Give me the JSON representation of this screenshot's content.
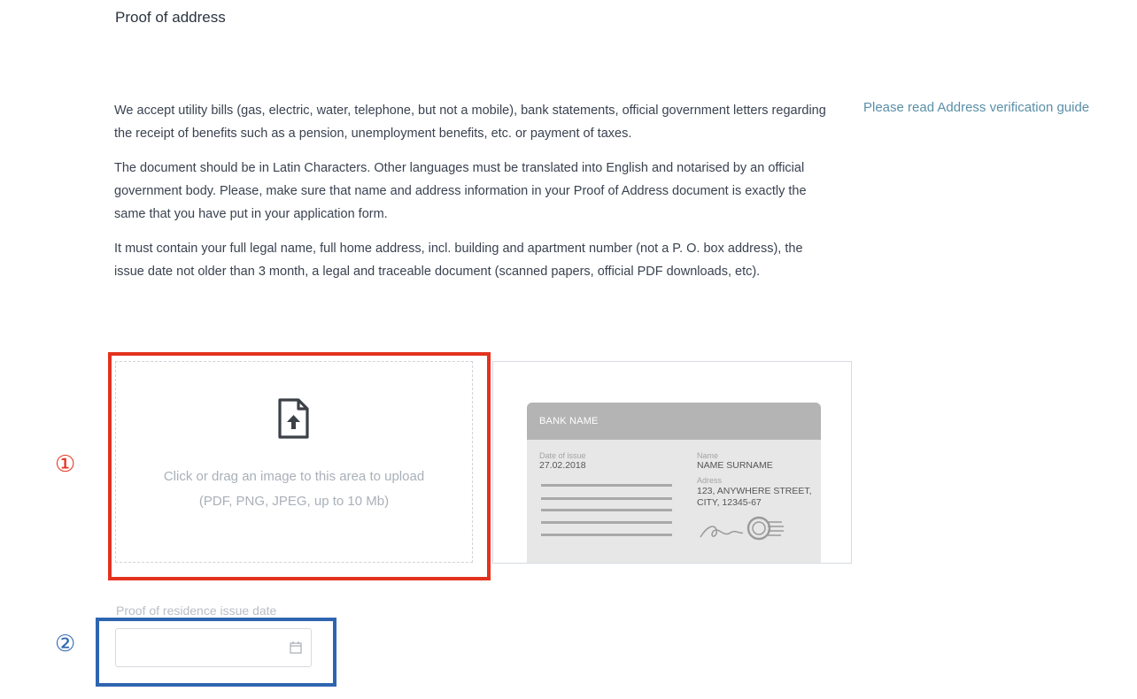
{
  "section": {
    "title": "Proof of address"
  },
  "description": {
    "paragraphs": [
      "We accept utility bills (gas, electric, water, telephone, but not a mobile), bank statements, official government letters regarding the receipt of benefits such as a pension, unemployment benefits, etc. or payment of taxes.",
      "The document should be in Latin Characters. Other languages must be translated into English and notarised by an official government body. Please, make sure that name and address information in your Proof of Address document is exactly the same that you have put in your application form.",
      "It must contain your full legal name, full home address, incl. building and apartment number (not a P. O. box address), the issue date not older than 3 month, a legal and traceable document (scanned papers, official PDF downloads, etc)."
    ]
  },
  "guide_link": {
    "label": "Please read Address verification guide"
  },
  "upload": {
    "icon": "file-upload-icon",
    "text_line1": "Click or drag an image to this area to upload",
    "text_line2": "(PDF, PNG, JPEG, up to 10 Mb)"
  },
  "sample_document": {
    "bank_name": "BANK NAME",
    "date_of_issue_label": "Date of issue",
    "date_of_issue_value": "27.02.2018",
    "name_label": "Name",
    "name_value": "NAME SURNAME",
    "address_label": "Adress",
    "address_line1": "123, ANYWHERE STREET,",
    "address_line2": "CITY, 12345-67"
  },
  "date_field": {
    "label": "Proof of residence issue date",
    "value": "",
    "icon": "calendar-icon"
  },
  "annotations": {
    "marker1": "①",
    "marker2": "②",
    "marker1_color": "#e3321e",
    "marker2_color": "#2e65b0"
  }
}
